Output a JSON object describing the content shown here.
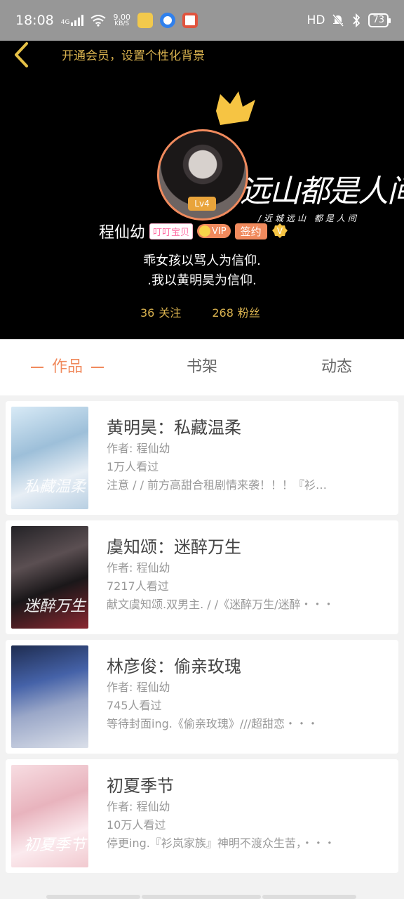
{
  "status_bar": {
    "time": "18:08",
    "network": "4G",
    "speed_value": "9.00",
    "speed_unit": "KB/S",
    "hd": "HD",
    "battery": "73"
  },
  "header": {
    "vip_promo": "开通会员，设置个性化背景",
    "background_title": "远山都是人间",
    "background_subtitle": "/近城远山 都是人间",
    "level": "Lv4",
    "nickname": "程仙幼",
    "fan_tag": "叮叮宝贝",
    "vip_label": "VIP",
    "signed_label": "签约",
    "verified_letter": "V",
    "bio_line1": "乖女孩以骂人为信仰.",
    "bio_line2": ".我以黄明昊为信仰.",
    "following_count": "36",
    "following_label": "关注",
    "fans_count": "268",
    "fans_label": "粉丝"
  },
  "tabs": [
    {
      "label": "作品"
    },
    {
      "label": "书架"
    },
    {
      "label": "动态"
    }
  ],
  "works": [
    {
      "title": "黄明昊：私藏温柔",
      "author": "作者: 程仙幼",
      "views": "1万人看过",
      "desc": "注意 /  / 前方高甜合租剧情来袭！！！『衫…",
      "cover_text": "私藏温柔"
    },
    {
      "title": "虞知颂：迷醉万生",
      "author": "作者: 程仙幼",
      "views": "7217人看过",
      "desc": "献文虞知颂.双男主. /  /《迷醉万生/迷醉・・・",
      "cover_text": "迷醉万生"
    },
    {
      "title": "林彦俊：偷亲玫瑰",
      "author": "作者: 程仙幼",
      "views": "745人看过",
      "desc": "等待封面ing.《偷亲玫瑰》///超甜恋・・・",
      "cover_text": ""
    },
    {
      "title": "初夏季节",
      "author": "作者: 程仙幼",
      "views": "10万人看过",
      "desc": "停更ing.『衫岚家族』神明不渡众生苦，・・・",
      "cover_text": "初夏季节"
    }
  ],
  "colors": {
    "accent": "#f08a5d",
    "gold": "#d9b24f",
    "header_bg": "#000000"
  }
}
